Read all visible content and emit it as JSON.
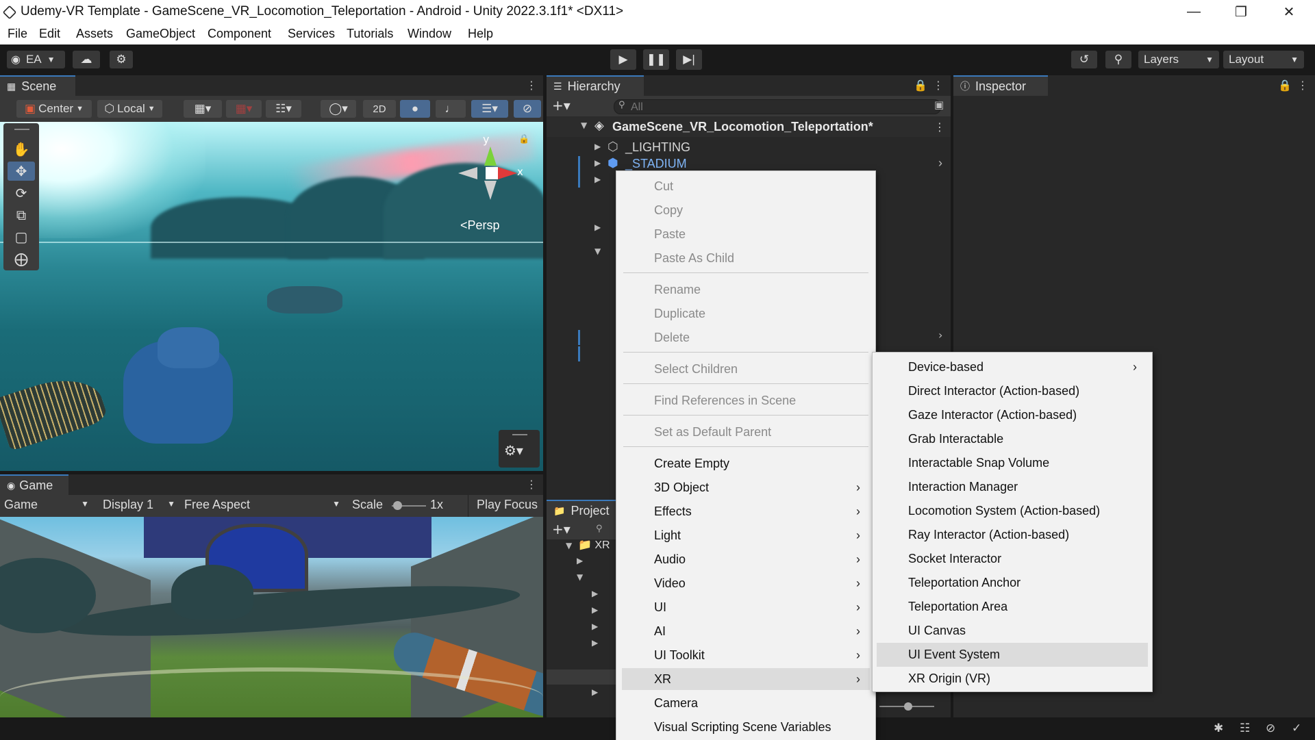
{
  "window": {
    "title": "Udemy-VR Template - GameScene_VR_Locomotion_Teleportation - Android - Unity 2022.3.1f1* <DX11>",
    "minimize_icon": "minimize-icon",
    "restore_icon": "restore-icon",
    "close_icon": "close-icon"
  },
  "menubar": {
    "items": [
      "File",
      "Edit",
      "Assets",
      "GameObject",
      "Component",
      "Services",
      "Tutorials",
      "Window",
      "Help"
    ]
  },
  "toolbar": {
    "account": "EA",
    "layers": "Layers",
    "layout": "Layout"
  },
  "scene": {
    "tab": "Scene",
    "pivot": "Center",
    "space": "Local",
    "mode_2d": "2D",
    "gizmo_y": "y",
    "gizmo_x": "x",
    "persp": "Persp"
  },
  "game": {
    "tab": "Game",
    "mode": "Game",
    "display": "Display 1",
    "aspect": "Free Aspect",
    "scale_label": "Scale",
    "scale_value": "1x",
    "play_focus": "Play Focus"
  },
  "hierarchy": {
    "tab": "Hierarchy",
    "search_placeholder": "All",
    "scene_name": "GameScene_VR_Locomotion_Teleportation*",
    "items": [
      "_LIGHTING",
      "_STADIUM"
    ]
  },
  "inspector": {
    "tab": "Inspector"
  },
  "project": {
    "tab": "Project",
    "folder_xr": "XR"
  },
  "context_menu": {
    "edit_items": [
      "Cut",
      "Copy",
      "Paste",
      "Paste As Child"
    ],
    "object_items": [
      "Rename",
      "Duplicate",
      "Delete"
    ],
    "select_children": "Select Children",
    "find_references": "Find References in Scene",
    "default_parent": "Set as Default Parent",
    "create_items": [
      "Create Empty",
      "3D Object",
      "Effects",
      "Light",
      "Audio",
      "Video",
      "UI",
      "AI",
      "UI Toolkit",
      "XR",
      "Camera",
      "Visual Scripting Scene Variables"
    ],
    "highlighted": "XR"
  },
  "xr_submenu": {
    "items": [
      "Device-based",
      "Direct Interactor (Action-based)",
      "Gaze Interactor (Action-based)",
      "Grab Interactable",
      "Interactable Snap Volume",
      "Interaction Manager",
      "Locomotion System (Action-based)",
      "Ray Interactor (Action-based)",
      "Socket Interactor",
      "Teleportation Anchor",
      "Teleportation Area",
      "UI Canvas",
      "UI Event System",
      "XR Origin (VR)"
    ],
    "highlighted": "UI Event System"
  },
  "colors": {
    "accent": "#3a79bb",
    "prefab_blue": "#7fb4f5",
    "menu_bg": "#f2f2f2",
    "panel_bg": "#282828"
  }
}
